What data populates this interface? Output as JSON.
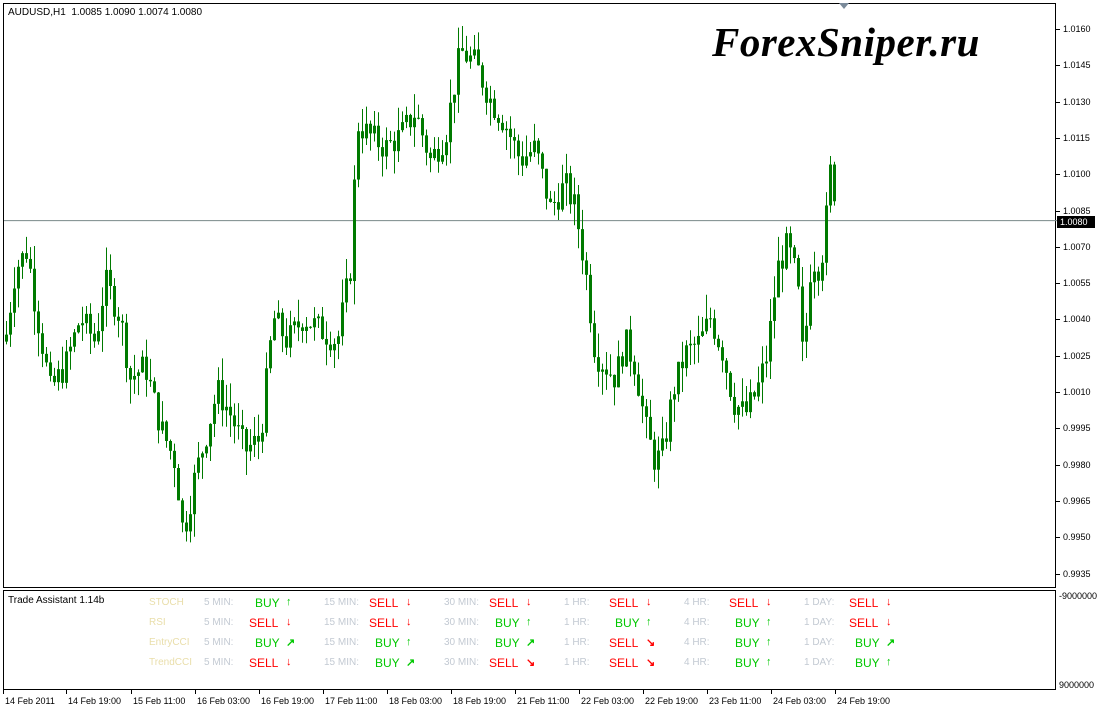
{
  "chart": {
    "header": "AUDUSD,H1  1.0085 1.0090 1.0074 1.0080",
    "watermark": "ForexSniper.ru",
    "current_price": "1.0080",
    "price_labels": [
      "1.0160",
      "1.0145",
      "1.0130",
      "1.0115",
      "1.0100",
      "1.0085",
      "1.0070",
      "1.0055",
      "1.0040",
      "1.0025",
      "1.0010",
      "0.9995",
      "0.9980",
      "0.9965",
      "0.9950",
      "0.9935"
    ],
    "candle_color": "#007a00",
    "price_min": 0.993,
    "price_max": 1.017
  },
  "panel": {
    "title": "Trade Assistant 1.14b",
    "scale_top": "-9000000",
    "scale_bottom": "9000000",
    "buy_color": "#00c800",
    "sell_color": "#ff0000",
    "indicator_color": "#e9deaa",
    "timeframe_color": "#c3cad3",
    "timeframes": [
      "5 MIN:",
      "15 MIN:",
      "30 MIN:",
      "1 HR:",
      "4 HR:",
      "1 DAY:"
    ],
    "rows": [
      {
        "indicator": "STOCH",
        "signals": [
          {
            "label": "BUY",
            "dir": "up"
          },
          {
            "label": "SELL",
            "dir": "down"
          },
          {
            "label": "SELL",
            "dir": "down"
          },
          {
            "label": "SELL",
            "dir": "down"
          },
          {
            "label": "SELL",
            "dir": "down"
          },
          {
            "label": "SELL",
            "dir": "down"
          }
        ]
      },
      {
        "indicator": "RSI",
        "signals": [
          {
            "label": "SELL",
            "dir": "down"
          },
          {
            "label": "SELL",
            "dir": "down"
          },
          {
            "label": "BUY",
            "dir": "up"
          },
          {
            "label": "BUY",
            "dir": "up"
          },
          {
            "label": "BUY",
            "dir": "up"
          },
          {
            "label": "SELL",
            "dir": "down"
          }
        ]
      },
      {
        "indicator": "EntryCCI",
        "signals": [
          {
            "label": "BUY",
            "dir": "up-right"
          },
          {
            "label": "BUY",
            "dir": "up"
          },
          {
            "label": "BUY",
            "dir": "up-right"
          },
          {
            "label": "SELL",
            "dir": "down-right"
          },
          {
            "label": "BUY",
            "dir": "up"
          },
          {
            "label": "BUY",
            "dir": "up-right"
          }
        ]
      },
      {
        "indicator": "TrendCCI",
        "signals": [
          {
            "label": "SELL",
            "dir": "down"
          },
          {
            "label": "BUY",
            "dir": "up-right"
          },
          {
            "label": "SELL",
            "dir": "down-right"
          },
          {
            "label": "SELL",
            "dir": "down-right"
          },
          {
            "label": "BUY",
            "dir": "up"
          },
          {
            "label": "BUY",
            "dir": "up"
          }
        ]
      }
    ]
  },
  "time_labels": [
    "14 Feb 2011",
    "14 Feb 19:00",
    "15 Feb 11:00",
    "16 Feb 03:00",
    "16 Feb 19:00",
    "17 Feb 11:00",
    "18 Feb 03:00",
    "18 Feb 19:00",
    "21 Feb 11:00",
    "22 Feb 03:00",
    "22 Feb 19:00",
    "23 Feb 11:00",
    "24 Feb 03:00",
    "24 Feb 19:00"
  ],
  "arrow_glyphs": {
    "up": "↑",
    "down": "↓",
    "up-right": "↗",
    "down-right": "↘"
  }
}
